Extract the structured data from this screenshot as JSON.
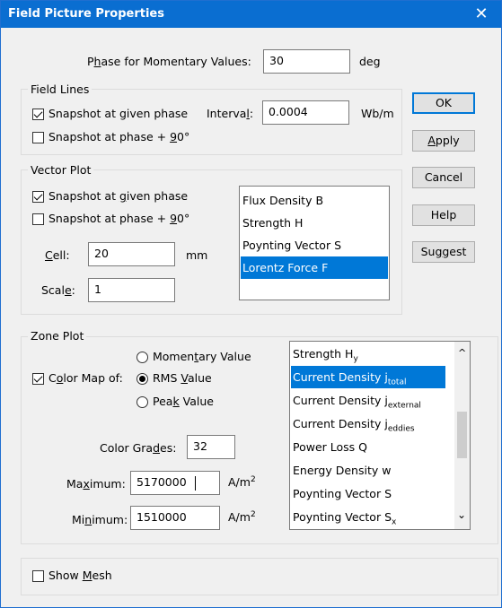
{
  "window": {
    "title": "Field Picture Properties",
    "close": "✕"
  },
  "phase": {
    "label_pre": "P",
    "label_ul": "h",
    "label_post": "ase for Momentary Values:",
    "value": "30",
    "unit": "deg"
  },
  "field_lines": {
    "title": "Field Lines",
    "snap_given": {
      "label": "Snapshot at given phase",
      "checked": true
    },
    "snap_90": {
      "pre": "Snapshot at phase + ",
      "ul": "9",
      "post": "0°",
      "checked": false
    },
    "interval_pre": "Interva",
    "interval_ul": "l",
    "interval_post": ":",
    "interval_value": "0.0004",
    "interval_unit": "Wb/m"
  },
  "vector_plot": {
    "title": "Vector Plot",
    "snap_given": {
      "pre": "Snapshot at ",
      "ul": "g",
      "post": "iven phase",
      "checked": true
    },
    "snap_90": {
      "pre": "Snapshot at phase + ",
      "ul": "9",
      "post": "0°",
      "checked": false
    },
    "cell": {
      "ul": "C",
      "post": "ell:",
      "value": "20",
      "unit": "mm"
    },
    "scale": {
      "pre": "Scal",
      "ul": "e",
      "post": ":",
      "value": "1"
    },
    "list": [
      "Flux Density B",
      "Strength H",
      "Poynting Vector S",
      "Lorentz Force F"
    ],
    "selected": "Lorentz Force F"
  },
  "zone_plot": {
    "title": "Zone Plot",
    "color_map": {
      "pre": "C",
      "ul": "o",
      "post": "lor Map of:",
      "checked": true
    },
    "radios": [
      {
        "pre": "Momen",
        "ul": "t",
        "post": "ary Value",
        "on": false
      },
      {
        "pre": "RMS ",
        "ul": "V",
        "post": "alue",
        "on": true
      },
      {
        "pre": "Pea",
        "ul": "k",
        "post": " Value",
        "on": false
      }
    ],
    "grades": {
      "pre": "Color Gra",
      "ul": "d",
      "post": "es:",
      "value": "32"
    },
    "maximum": {
      "pre": "Ma",
      "ul": "x",
      "post": "imum:",
      "value": "5170000",
      "unit": "A/m",
      "sup": "2"
    },
    "minimum": {
      "pre": "Mi",
      "ul": "n",
      "post": "imum:",
      "value": "1510000",
      "unit": "A/m",
      "sup": "2"
    },
    "list": [
      {
        "main": "Strength H",
        "sub": "y"
      },
      {
        "main": "Current Density j",
        "sub": "total"
      },
      {
        "main": "Current Density j",
        "sub": "external"
      },
      {
        "main": "Current Density j",
        "sub": "eddies"
      },
      {
        "main": "Power Loss Q",
        "sub": ""
      },
      {
        "main": "Energy Density w",
        "sub": ""
      },
      {
        "main": "Poynting Vector S",
        "sub": ""
      },
      {
        "main": "Poynting Vector S",
        "sub": "x"
      }
    ],
    "selected_index": 1,
    "scroll_up": "^",
    "scroll_down": "⌄"
  },
  "show_mesh": {
    "pre": "Show ",
    "ul": "M",
    "post": "esh",
    "checked": false
  },
  "buttons": {
    "ok": "OK",
    "apply": {
      "ul": "A",
      "post": "pply"
    },
    "cancel": "Cancel",
    "help": "Help",
    "suggest": {
      "pre": "Su",
      "ul": "g",
      "post": "gest"
    }
  }
}
